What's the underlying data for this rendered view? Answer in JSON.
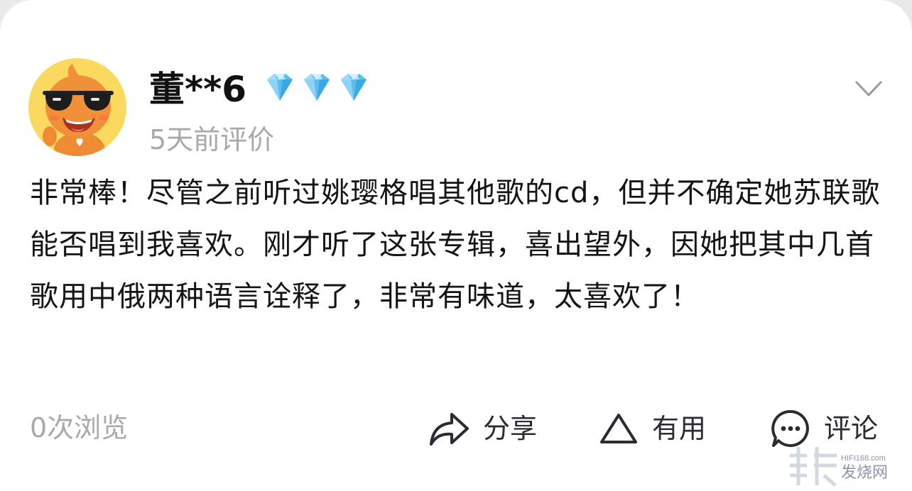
{
  "review": {
    "username": "董**6",
    "member_level_icons": [
      "diamond-icon",
      "diamond-icon",
      "diamond-icon"
    ],
    "time_text": "5天前评价",
    "content": "非常棒！尽管之前听过姚璎格唱其他歌的cd，但并不确定她苏联歌能否唱到我喜欢。刚才听了这张专辑，喜出望外，因她把其中几首歌用中俄两种语言诠释了，非常有味道，太喜欢了！",
    "views_text": "0次浏览",
    "actions": {
      "share_label": "分享",
      "useful_label": "有用",
      "comment_label": "评论"
    }
  },
  "watermark": {
    "site": "HIFI168.com",
    "name": "发烧网"
  },
  "colors": {
    "background": "#ffffff",
    "text_primary": "#141414",
    "text_secondary": "#a8a8ad",
    "diamond": "#6fc8f2",
    "avatar_bg": "#fbd95e",
    "avatar_character": "#f0913a"
  }
}
